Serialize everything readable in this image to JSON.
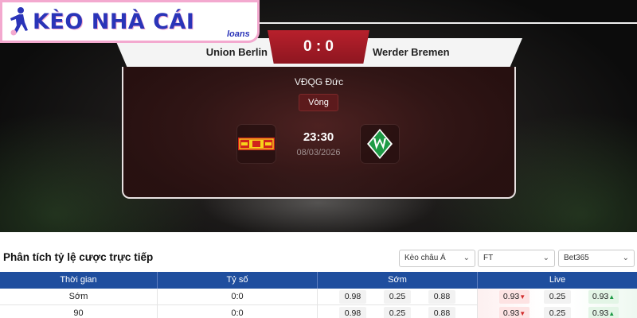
{
  "brand": {
    "name": "KÈO NHÀ CÁI",
    "suffix": "loans",
    "accent": "#2a34b8",
    "border": "#f3a9cf"
  },
  "match": {
    "home": "Union Berlin",
    "away": "Werder Bremen",
    "score": "0 : 0",
    "league": "VĐQG Đức",
    "round": "Vòng",
    "time": "23:30",
    "date": "08/03/2026",
    "home_crest": "union-berlin-crest",
    "away_crest": "werder-bremen-crest"
  },
  "odds": {
    "title": "Phân tích tỷ lệ cược trực tiếp",
    "filters": [
      "Kèo châu Á",
      "FT",
      "Bet365"
    ],
    "headers": [
      "Thời gian",
      "Tỷ số",
      "Sớm",
      "Live"
    ],
    "rows": [
      {
        "time": "Sớm",
        "score": "0:0",
        "early": [
          "0.98",
          "0.25",
          "0.88"
        ],
        "live": [
          "0.93",
          "0.25",
          "0.93"
        ]
      },
      {
        "time": "90",
        "score": "0:0",
        "early": [
          "0.98",
          "0.25",
          "0.88"
        ],
        "live": [
          "0.93",
          "0.25",
          "0.93"
        ]
      }
    ],
    "colors": {
      "header": "#1f4e9e",
      "down": "#d12a2a",
      "up": "#1d9a45"
    }
  }
}
